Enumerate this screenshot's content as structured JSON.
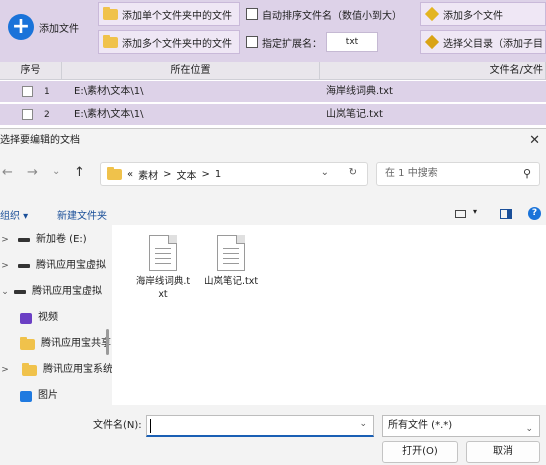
{
  "toolbar": {
    "add_file": "添加文件",
    "add_single_folder": "添加单个文件夹中的文件",
    "add_multi_folder": "添加多个文件夹中的文件",
    "auto_sort": "自动排序文件名（数值小到大）",
    "specify_ext": "指定扩展名：",
    "ext_value": "txt",
    "add_multi_right": "添加多个文件",
    "select_parent": "选择父目录（添加子目"
  },
  "table": {
    "headers": [
      "序号",
      "所在位置",
      "文件名/文件"
    ],
    "rows": [
      {
        "index": "1",
        "location": "E:\\素材\\文本\\1\\",
        "name": "海岸线词典.txt"
      },
      {
        "index": "2",
        "location": "E:\\素材\\文本\\1\\",
        "name": "山岚笔记.txt"
      }
    ]
  },
  "dialog": {
    "title": "选择要编辑的文档",
    "path": [
      "«",
      "素材",
      ">",
      "文本",
      ">",
      "1"
    ],
    "search_placeholder": "在 1 中搜索",
    "organize": "组织 ▾",
    "new_folder": "新建文件夹",
    "sidebar": [
      {
        "label": "新加卷 (E:)",
        "chevron": ">"
      },
      {
        "label": "腾讯应用宝虚拟",
        "chevron": ">"
      },
      {
        "label": "腾讯应用宝虚拟",
        "chevron": "⌄"
      },
      {
        "label": "视频",
        "chevron": ""
      },
      {
        "label": "腾讯应用宝共享",
        "chevron": ""
      },
      {
        "label": "腾讯应用宝系统",
        "chevron": ">"
      },
      {
        "label": "图片",
        "chevron": ""
      }
    ],
    "files": [
      {
        "name": "海岸线词典.txt"
      },
      {
        "name": "山岚笔记.txt"
      }
    ],
    "filename_label": "文件名(N):",
    "filename_value": "",
    "filetype": "所有文件 (*.*)",
    "open": "打开(O)",
    "cancel": "取消"
  },
  "colors": {
    "accent": "#1a73d9",
    "toolbar_bg": "#ddd2e8",
    "dialog_bg": "#f3f3f3"
  }
}
